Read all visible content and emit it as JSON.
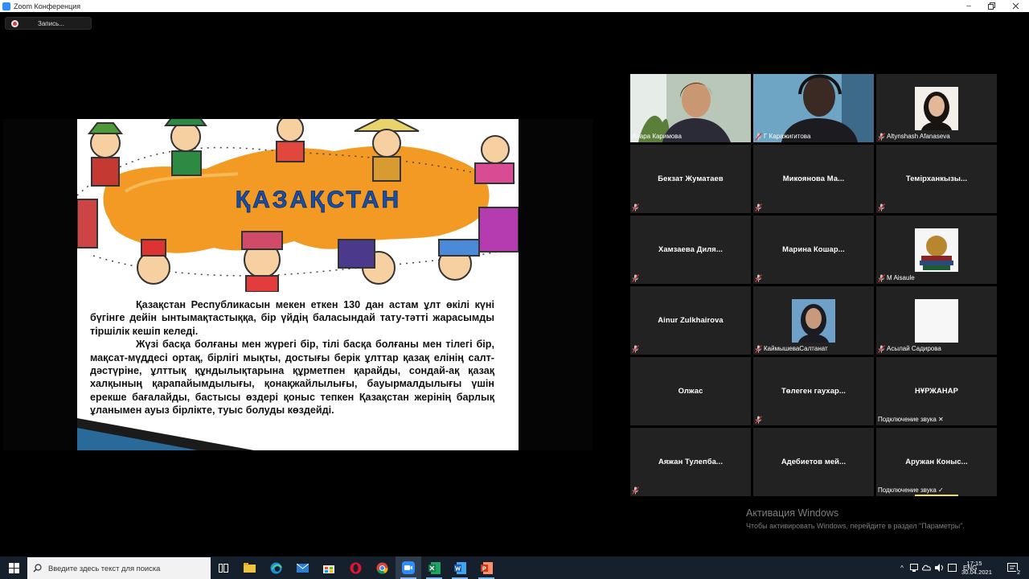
{
  "window": {
    "title": "Zoom Конференция"
  },
  "recording": {
    "label": "Запись..."
  },
  "slide": {
    "heading": "ҚАЗАҚСТАН",
    "paragraph1": "Қазақстан Республикасын мекен еткен 130 дан астам ұлт өкілі күні бүгінге дейін ынтымақтастыққа, бір үйдің баласындай тату-тәтті жарасымды тіршілік кешіп келеді.",
    "paragraph2": "Жүзі басқа болғаны мен жүрегі бір, тілі басқа болғаны мен тілегі бір, мақсат-мүддесі ортақ, бірлігі мықты, достығы берік ұлттар қазақ елінің салт-дәстүріне, ұлттық құндылықтарына құрметпен қарайды, сондай-ақ қазақ халқының қарапайымдылығы, қонақжайлылығы, бауырмалдылығы үшін ерекше бағалайды, бастысы өздері қоныс тепкен Қазақстан жерінің барлық ұланымен ауыз бірлікте, туыс болуды көздейді."
  },
  "participants": [
    {
      "name": "Анара Каримова",
      "kind": "video-active",
      "muted": false
    },
    {
      "name": "Г Каражигитова",
      "kind": "video",
      "muted": true
    },
    {
      "name": "Altynshash Afanaseva",
      "kind": "photo",
      "muted": true
    },
    {
      "name": "Бекзат Жуматаев",
      "kind": "name",
      "muted": true
    },
    {
      "name": "Микоянова  Ма...",
      "kind": "name",
      "muted": true
    },
    {
      "name": "Темірханкызы...",
      "kind": "name",
      "muted": true
    },
    {
      "name": "Хамзаева  Диля...",
      "kind": "name",
      "muted": true
    },
    {
      "name": "Марина  Кошар...",
      "kind": "name",
      "muted": true
    },
    {
      "name": "M Aisaule",
      "kind": "photo",
      "muted": true
    },
    {
      "name": "Ainur Zulkhairova",
      "kind": "name",
      "muted": true
    },
    {
      "name": "КаймышеваСалтанат",
      "kind": "photo",
      "muted": true
    },
    {
      "name": "Асылай Садирова",
      "kind": "photo",
      "muted": true
    },
    {
      "name": "Олжас",
      "kind": "name",
      "muted": false
    },
    {
      "name": "Төлеген  гаухар...",
      "kind": "name",
      "muted": true
    },
    {
      "name": "НҰРЖАНАР",
      "kind": "name",
      "muted": false,
      "status": "Подключение звука ✕"
    },
    {
      "name": "Аяжан  Тулепба...",
      "kind": "name",
      "muted": true
    },
    {
      "name": "Адебиетов  мей...",
      "kind": "name",
      "muted": false
    },
    {
      "name": "Аружан  Коныс...",
      "kind": "name",
      "muted": false,
      "status": "Подключение звука ✓"
    }
  ],
  "watermark": {
    "line1": "Активация Windows",
    "line2": "Чтобы активировать Windows, перейдите в раздел \"Параметры\"."
  },
  "taskbar": {
    "search_placeholder": "Введите здесь текст для поиска",
    "lang": "ENG",
    "time": "17:15",
    "date": "30.04.2021",
    "notifications": "2"
  }
}
